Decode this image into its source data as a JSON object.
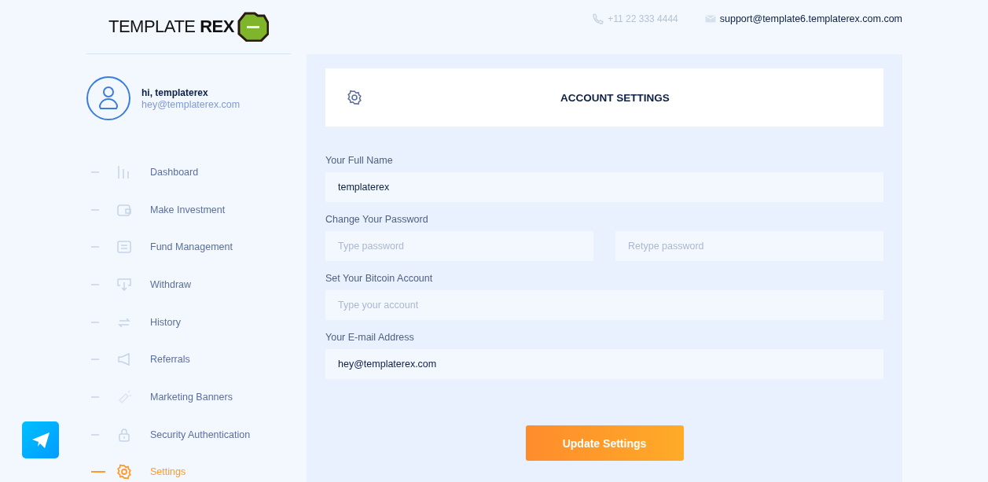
{
  "logo": {
    "text_light": "TEMPLATE",
    "text_bold": "REX"
  },
  "contacts": {
    "phone": "+11 22 333 4444",
    "email": "support@template6.templaterex.com.com"
  },
  "user": {
    "greeting": "hi, templaterex",
    "email": "hey@templaterex.com"
  },
  "sidebar": {
    "items": [
      {
        "label": "Dashboard",
        "selected": false
      },
      {
        "label": "Make Investment",
        "selected": false
      },
      {
        "label": "Fund Management",
        "selected": false
      },
      {
        "label": "Withdraw",
        "selected": false
      },
      {
        "label": "History",
        "selected": false
      },
      {
        "label": "Referrals",
        "selected": false
      },
      {
        "label": "Marketing Banners",
        "selected": false
      },
      {
        "label": "Security Authentication",
        "selected": false
      },
      {
        "label": "Settings",
        "selected": true
      }
    ]
  },
  "panel": {
    "title": "ACCOUNT SETTINGS"
  },
  "form": {
    "sections": [
      {
        "label": "Your Full Name",
        "fields": [
          {
            "value": "templaterex"
          }
        ]
      },
      {
        "label": "Change Your Password",
        "fields": [
          {
            "placeholder": "Type password"
          },
          {
            "placeholder": "Retype password"
          }
        ]
      },
      {
        "label": "Set Your Bitcoin Account",
        "fields": [
          {
            "placeholder": "Type your account"
          }
        ]
      },
      {
        "label": "Your E-mail Address",
        "fields": [
          {
            "value": "hey@templaterex.com"
          }
        ]
      }
    ],
    "submit": "Update Settings"
  }
}
